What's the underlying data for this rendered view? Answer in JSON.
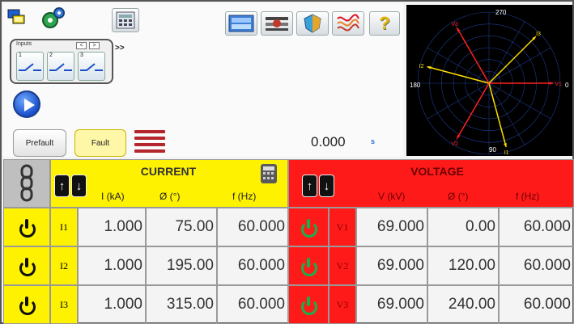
{
  "toolbar": {
    "icons": [
      "display-mode-icon",
      "settings-gear-icon",
      "calculator-panel-icon",
      "monitor-icon",
      "sequence-icon",
      "shield-icon",
      "waveform-icon",
      "help-icon"
    ],
    "help_label": "?"
  },
  "inputs": {
    "label": "Inputs",
    "prev": "<",
    "next": ">",
    "more": ">>",
    "tiles": [
      "1",
      "2",
      "3"
    ]
  },
  "controls": {
    "prefault": "Prefault",
    "fault": "Fault",
    "time_value": "0.000",
    "time_unit": "s"
  },
  "phasor": {
    "labels": {
      "top": "270",
      "bottom": "90",
      "left": "180",
      "right": "0"
    },
    "vectors": [
      {
        "name": "V1",
        "angle": 0,
        "magnitude": 0.9,
        "color": "#ff2020"
      },
      {
        "name": "I1",
        "angle": 75,
        "magnitude": 0.93,
        "color": "#ffe000"
      },
      {
        "name": "V2",
        "angle": 120,
        "magnitude": 0.9,
        "color": "#ff2020"
      },
      {
        "name": "I2",
        "angle": 195,
        "magnitude": 0.9,
        "color": "#ffe000"
      },
      {
        "name": "V3",
        "angle": 240,
        "magnitude": 0.9,
        "color": "#ff2020"
      },
      {
        "name": "I3",
        "angle": 315,
        "magnitude": 0.93,
        "color": "#ffe000"
      }
    ]
  },
  "current": {
    "title": "CURRENT",
    "col_mag": "I (kA)",
    "col_ang": "Ø (°)",
    "col_freq": "f (Hz)",
    "rows": [
      {
        "phase": "I1",
        "mag": "1.000",
        "ang": "75.00",
        "freq": "60.000"
      },
      {
        "phase": "I2",
        "mag": "1.000",
        "ang": "195.00",
        "freq": "60.000"
      },
      {
        "phase": "I3",
        "mag": "1.000",
        "ang": "315.00",
        "freq": "60.000"
      }
    ]
  },
  "voltage": {
    "title": "VOLTAGE",
    "col_mag": "V (kV)",
    "col_ang": "Ø (°)",
    "col_freq": "f (Hz)",
    "rows": [
      {
        "phase": "V1",
        "mag": "69.000",
        "ang": "0.00",
        "freq": "60.000"
      },
      {
        "phase": "V2",
        "mag": "69.000",
        "ang": "120.00",
        "freq": "60.000"
      },
      {
        "phase": "V3",
        "mag": "69.000",
        "ang": "240.00",
        "freq": "60.000"
      }
    ]
  },
  "colors": {
    "current_header": "#fff200",
    "voltage_header": "#ff1a1a"
  }
}
